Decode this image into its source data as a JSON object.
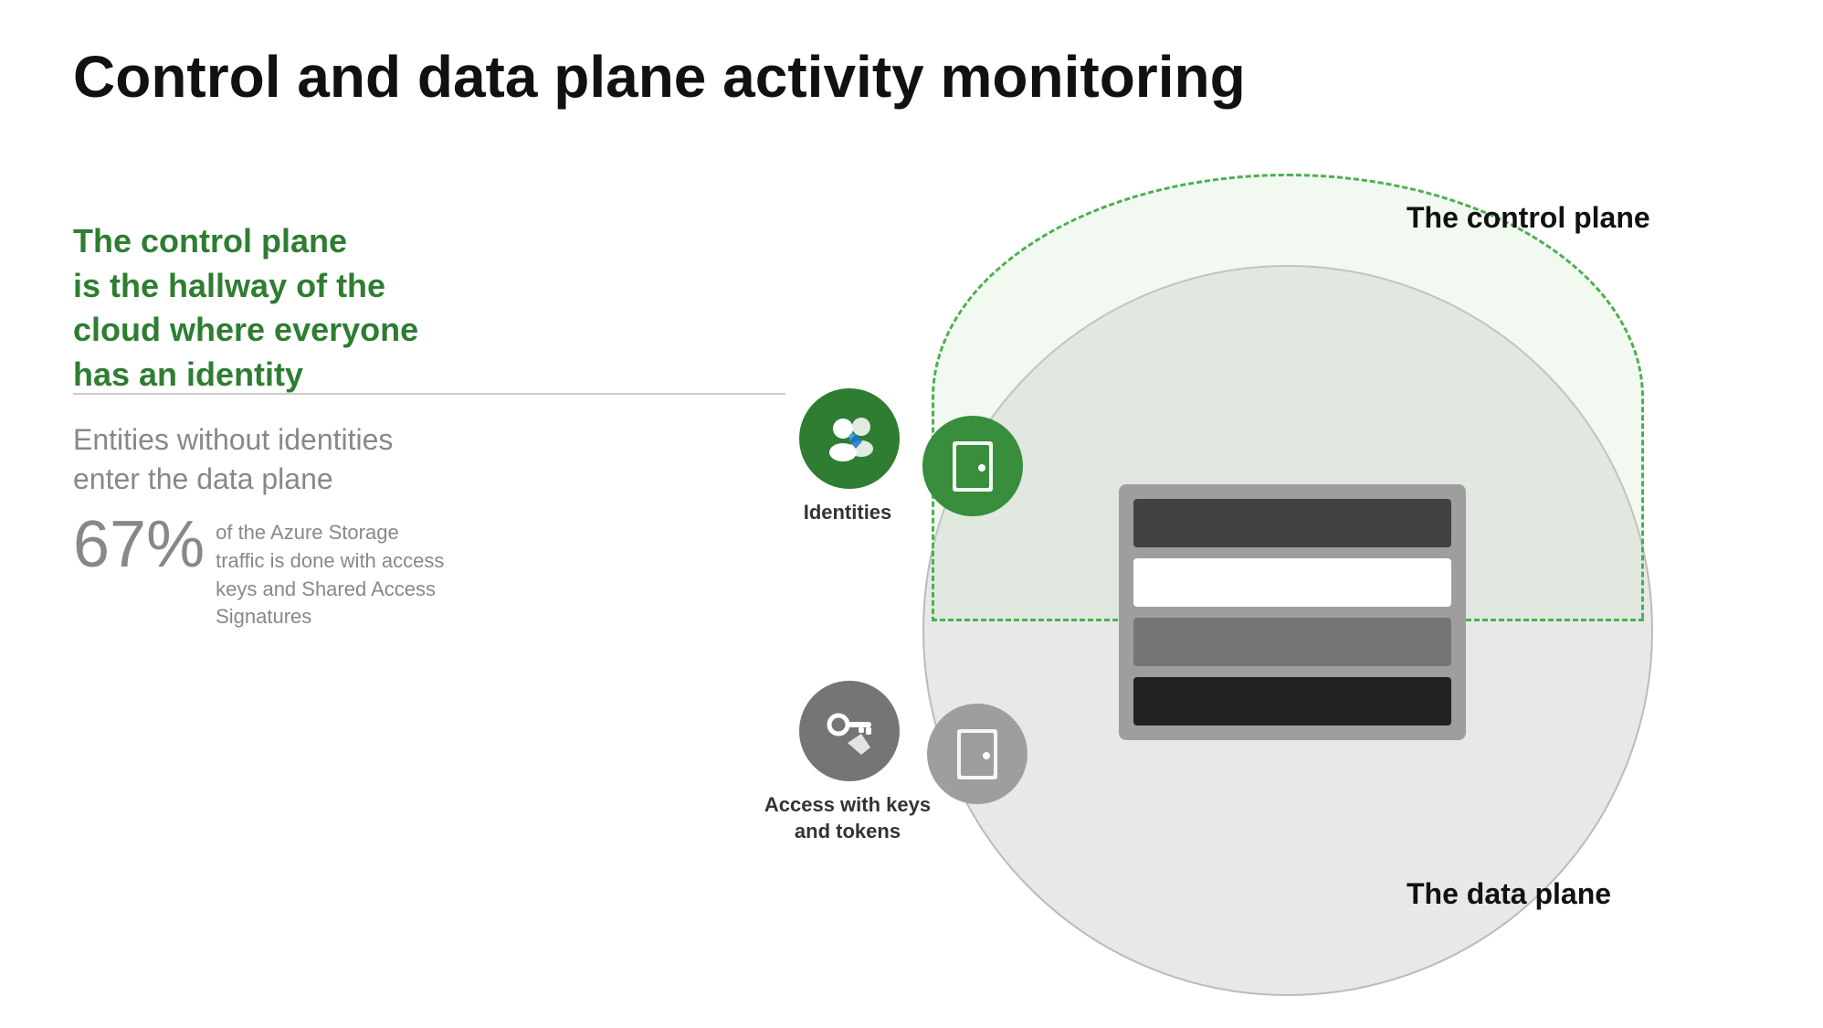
{
  "title": "Control and data plane activity monitoring",
  "green_text": {
    "line1": "The control plane",
    "line2": "is the hallway of the",
    "line3": "cloud where everyone",
    "line4": "has an identity"
  },
  "entities_text": {
    "line1": "Entities without identities",
    "line2": "enter the data plane"
  },
  "percent": {
    "number": "67%",
    "description": "of the Azure Storage traffic is done with access keys and Shared Access Signatures"
  },
  "diagram": {
    "control_plane_label": "The control plane",
    "data_plane_label": "The data plane",
    "identities_label": "Identities",
    "access_label": "Access with keys\nand tokens"
  }
}
